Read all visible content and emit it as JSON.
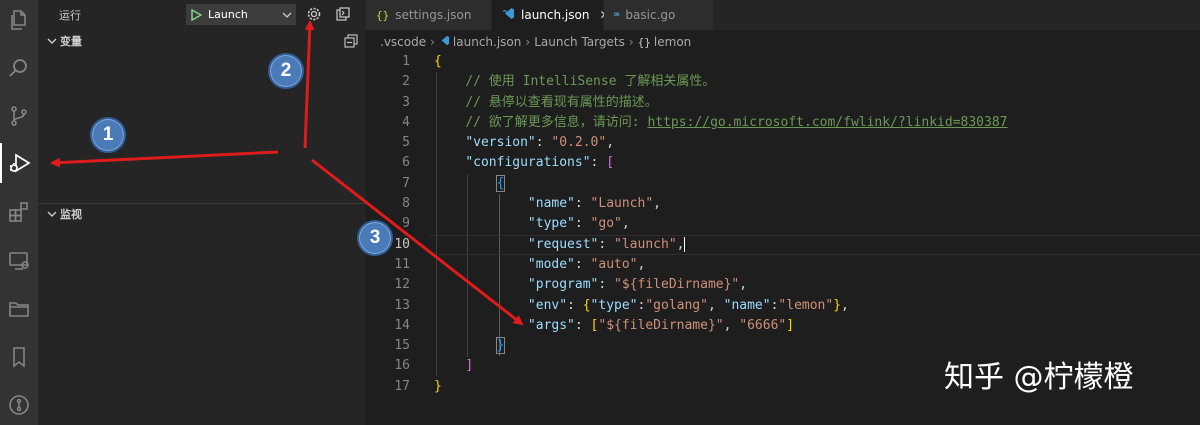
{
  "debug_toolbar": {
    "run_label": "运行",
    "config_selected": "Launch"
  },
  "sidebar": {
    "variables_title": "变量",
    "watch_title": "监视"
  },
  "tabs": [
    {
      "icon": "{}",
      "label": "settings.json"
    },
    {
      "icon": "{}",
      "label": "launch.json",
      "close": "✕"
    },
    {
      "icon": "GO",
      "label": "basic.go"
    }
  ],
  "breadcrumb": [
    ".vscode",
    "launch.json",
    "Launch Targets",
    "lemon"
  ],
  "breadcrumb_last_icon": "{}",
  "code": {
    "line_numbers": [
      "1",
      "2",
      "3",
      "4",
      "5",
      "6",
      "7",
      "8",
      "9",
      "10",
      "11",
      "12",
      "13",
      "14",
      "15",
      "16",
      "17"
    ],
    "comment1": "// 使用 IntelliSense 了解相关属性。",
    "comment2": "// 悬停以查看现有属性的描述。",
    "comment3_prefix": "// 欲了解更多信息，请访问: ",
    "comment3_link": "https://go.microsoft.com/fwlink/?linkid=830387",
    "version_key": "\"version\"",
    "version_val": "\"0.2.0\"",
    "configurations_key": "\"configurations\"",
    "name_key": "\"name\"",
    "name_val": "\"Launch\"",
    "type_key": "\"type\"",
    "type_val": "\"go\"",
    "request_key": "\"request\"",
    "request_val": "\"launch\"",
    "mode_key": "\"mode\"",
    "mode_val": "\"auto\"",
    "program_key": "\"program\"",
    "program_val": "\"${fileDirname}\"",
    "env_key": "\"env\"",
    "env_type_key": "\"type\"",
    "env_type_val": "\"golang\"",
    "env_name_key": "\"name\"",
    "env_name_val": "\"lemon\"",
    "args_key": "\"args\"",
    "args_val1": "\"${fileDirname}\"",
    "args_val2": "\"6666\""
  },
  "annotations": {
    "badge1": "1",
    "badge2": "2",
    "badge3": "3",
    "arrow_color": "#e01b1b"
  },
  "watermark": "知乎 @柠檬橙"
}
